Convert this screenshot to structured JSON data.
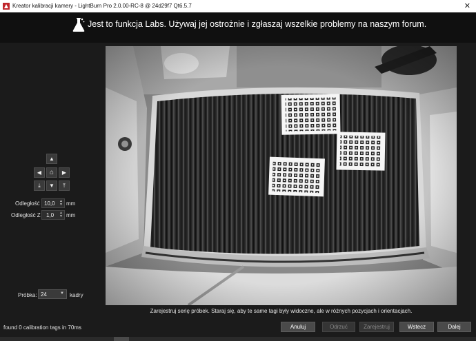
{
  "window": {
    "title": "Kreator kalibracji kamery - LightBurn Pro 2.0.00-RC-8 @ 24d29f7 Qt6.5.7",
    "close_glyph": "✕",
    "app_icon": "lightburn-logo-icon"
  },
  "banner": {
    "icon": "flask-icon",
    "message": "Jest to funkcja Labs. Używaj jej ostrożnie i zgłaszaj wszelkie problemy na naszym forum."
  },
  "nav": {
    "up": "▲",
    "left": "◀",
    "home": "⌂",
    "right": "▶",
    "down_stop": "⤓",
    "down": "▼",
    "up_stop": "⤒"
  },
  "distance": {
    "label": "Odległość",
    "value": "10,0",
    "unit": "mm"
  },
  "distance_z": {
    "label": "Odległość Z",
    "value": "1,0",
    "unit": "mm"
  },
  "sample": {
    "label": "Próbka:",
    "value": "24",
    "unit": "kadry"
  },
  "instructions": "Zarejestruj serię próbek. Staraj się, aby te same tagi były widoczne, ale w różnych pozycjach i orientacjach.",
  "status": "found 0 calibration tags in 70ms",
  "buttons": {
    "cancel": "Anuluj",
    "reject": "Odrzuć",
    "register": "Zarejestruj",
    "back": "Wstecz",
    "next": "Dalej"
  },
  "colors": {
    "background": "#1b1b1b",
    "banner": "#101010",
    "button": "#4a4a4a",
    "button_disabled": "#353535"
  }
}
